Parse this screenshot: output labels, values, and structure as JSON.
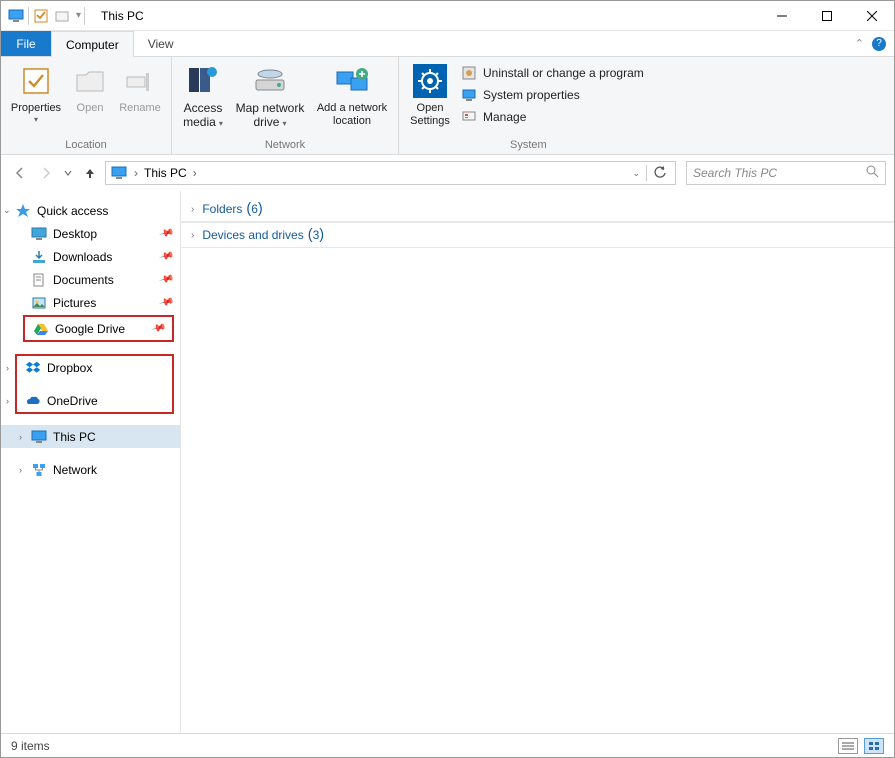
{
  "title_bar": {
    "window_title": "This PC"
  },
  "tabs": {
    "file": "File",
    "computer": "Computer",
    "view": "View"
  },
  "ribbon": {
    "location": {
      "label": "Location",
      "properties": "Properties",
      "open": "Open",
      "rename": "Rename"
    },
    "network": {
      "label": "Network",
      "access_media": "Access media",
      "map_drive": "Map network drive",
      "add_location": "Add a network location"
    },
    "settings": {
      "open_settings": "Open Settings"
    },
    "system": {
      "label": "System",
      "uninstall": "Uninstall or change a program",
      "system_properties": "System properties",
      "manage": "Manage"
    }
  },
  "address": {
    "location": "This PC",
    "separator": "›"
  },
  "search": {
    "placeholder": "Search This PC"
  },
  "sidebar": {
    "quick_access": "Quick access",
    "desktop": "Desktop",
    "downloads": "Downloads",
    "documents": "Documents",
    "pictures": "Pictures",
    "google_drive": "Google Drive",
    "dropbox": "Dropbox",
    "onedrive": "OneDrive",
    "this_pc": "This PC",
    "network": "Network"
  },
  "content": {
    "folders": {
      "label": "Folders",
      "count": 6
    },
    "devices": {
      "label": "Devices and drives",
      "count": 3
    }
  },
  "status": {
    "items": "9 items"
  }
}
